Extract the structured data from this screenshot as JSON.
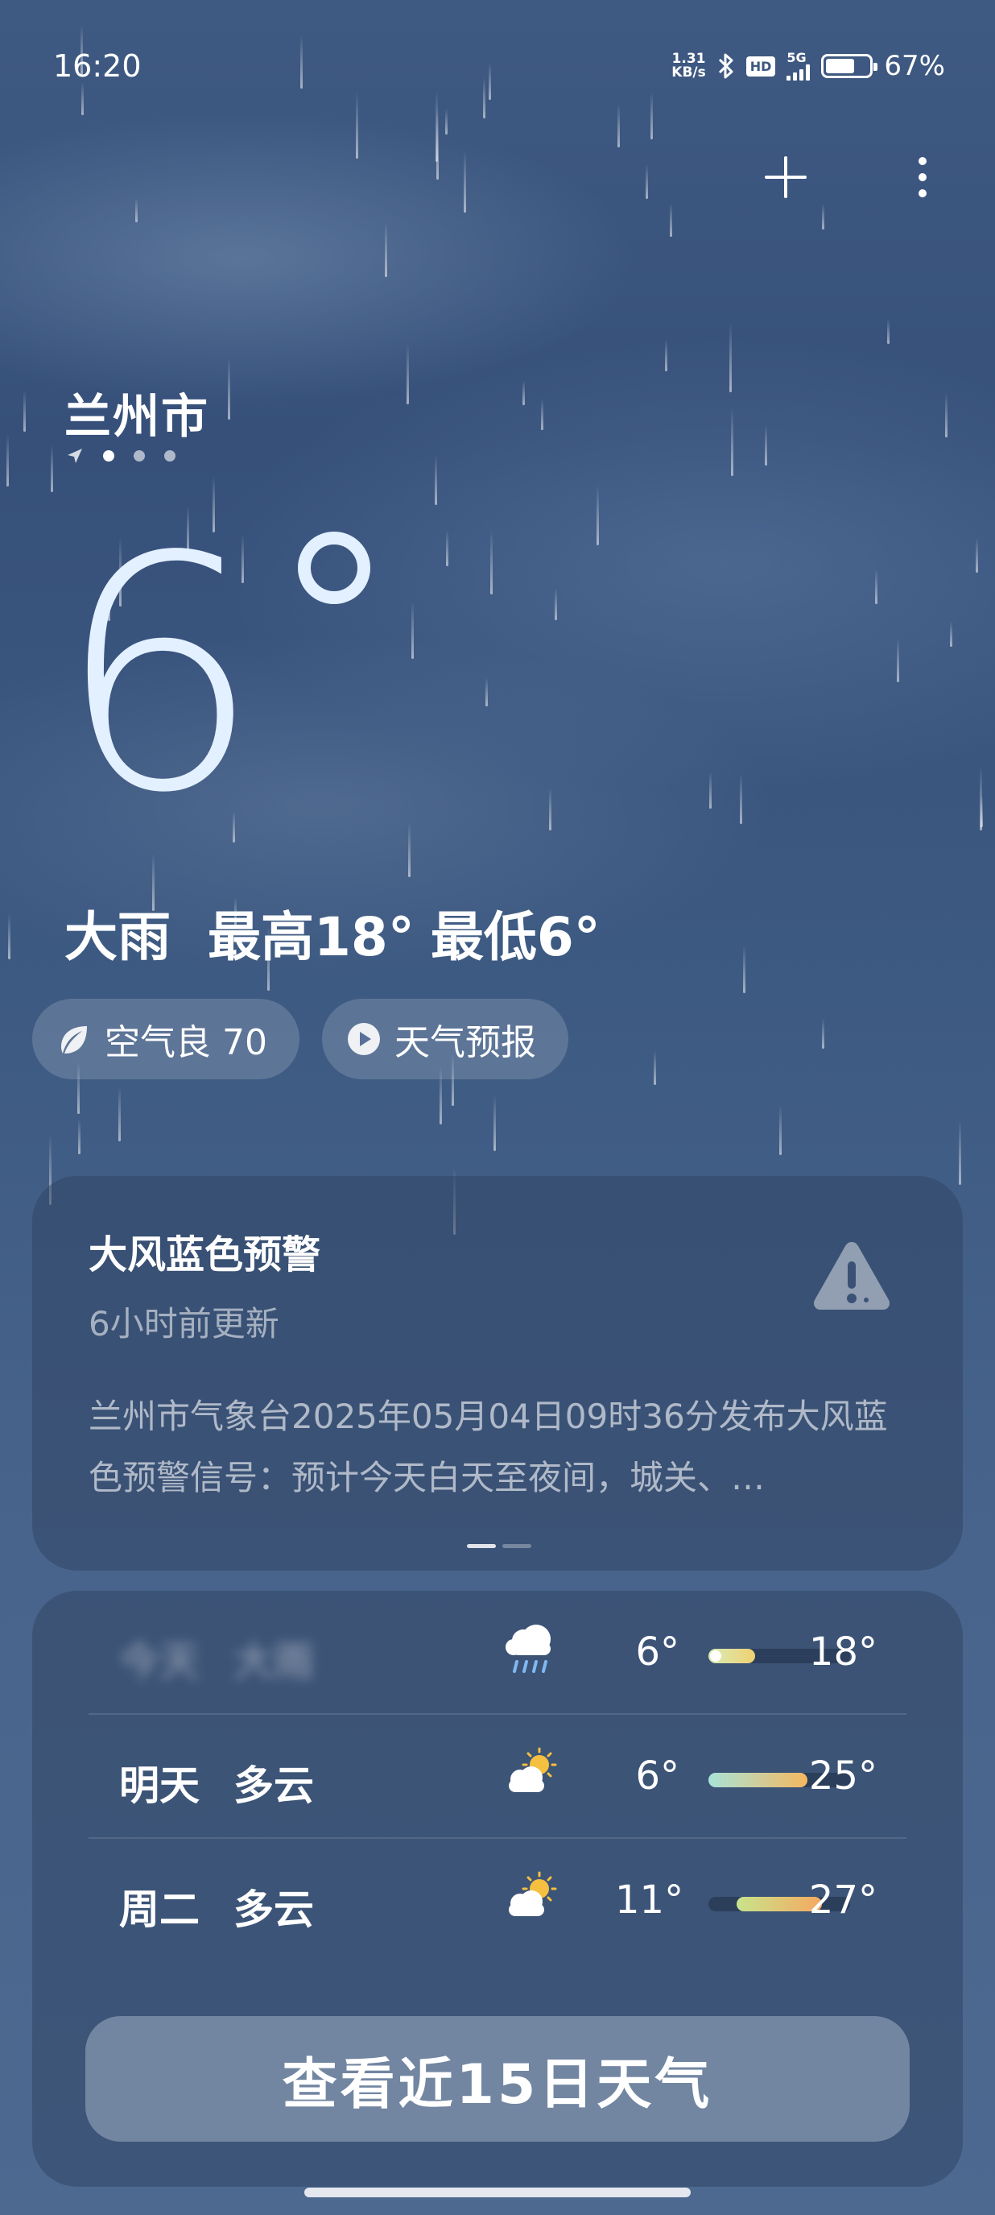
{
  "status_bar": {
    "time": "16:20",
    "net_speed_value": "1.31",
    "net_speed_unit": "KB/s",
    "hd_label": "HD",
    "network_label": "5G",
    "battery_percent": 67,
    "battery_text": "67%"
  },
  "header": {
    "add_icon": "plus-icon",
    "menu_icon": "more-vertical-icon"
  },
  "location": {
    "city": "兰州市",
    "pages": 3,
    "active_page": 0
  },
  "current": {
    "temperature": "6",
    "condition": "大雨",
    "high": "最高18°",
    "low": "最低6°"
  },
  "chips": {
    "air_quality": "空气良 70",
    "forecast_video": "天气预报"
  },
  "alert": {
    "title": "大风蓝色预警",
    "updated": "6小时前更新",
    "body": "兰州市气象台2025年05月04日09时36分发布大风蓝色预警信号：预计今天白天至夜间，城关、…",
    "icon": "warning-triangle-icon"
  },
  "forecast": {
    "rows": [
      {
        "day": "今天",
        "condition": "大雨",
        "icon": "heavy-rain-icon",
        "low": "6°",
        "high": "18°",
        "range_start": 0.0,
        "range_end": 0.33,
        "current": 0.0,
        "colors": [
          "#d8ecb8",
          "#f0d070"
        ]
      },
      {
        "day": "明天",
        "condition": "多云",
        "icon": "partly-cloudy-icon",
        "low": "6°",
        "high": "25°",
        "range_start": 0.0,
        "range_end": 0.7,
        "current": null,
        "colors": [
          "#a8e4d8",
          "#f5b860"
        ]
      },
      {
        "day": "周二",
        "condition": "多云",
        "icon": "partly-cloudy-icon",
        "low": "11°",
        "high": "27°",
        "range_start": 0.2,
        "range_end": 0.8,
        "current": null,
        "colors": [
          "#c8e48c",
          "#f5a860"
        ]
      }
    ],
    "button_label": "查看近15日天气"
  }
}
